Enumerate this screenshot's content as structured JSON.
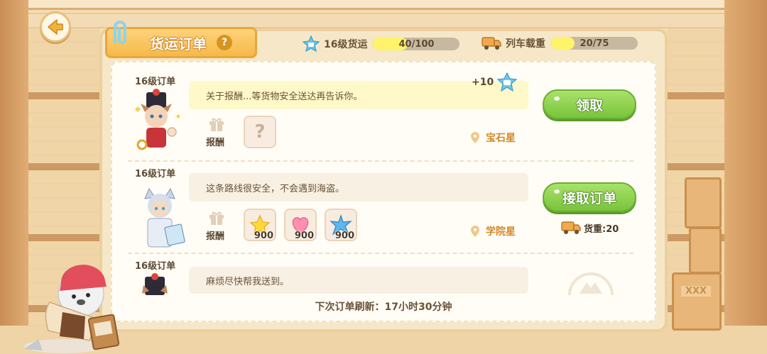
{
  "header": {
    "title": "货运订单",
    "help": "?",
    "cargo_level": {
      "label": "16级货运",
      "value": "40/100",
      "progress": 0.4
    },
    "train_load": {
      "label": "列车载重",
      "value": "20/75",
      "progress": 0.27
    }
  },
  "orders": [
    {
      "level": "16级订单",
      "message": "关于报酬...等货物安全送达再告诉你。",
      "reward_label": "报酬",
      "unknown_slot": "?",
      "bonus": "+10",
      "location": "宝石星",
      "button": "领取"
    },
    {
      "level": "16级订单",
      "message": "这条路线很安全，不会遇到海盗。",
      "reward_label": "报酬",
      "rewards": [
        {
          "icon": "yellow-star-icon",
          "count": "900"
        },
        {
          "icon": "pink-heart-icon",
          "count": "900"
        },
        {
          "icon": "blue-star-icon",
          "count": "900"
        }
      ],
      "location": "学院星",
      "button": "接取订单",
      "weight": "货重:20"
    },
    {
      "level": "16级订单",
      "message": "麻烦尽快帮我送到。"
    }
  ],
  "footer": {
    "refresh": "下次订单刷新：17小时30分钟"
  },
  "decor": {
    "crate_label": "XXX"
  },
  "colors": {
    "accent_green": "#79c33c",
    "title_orange": "#f5b949",
    "location_orange": "#d4882c"
  }
}
